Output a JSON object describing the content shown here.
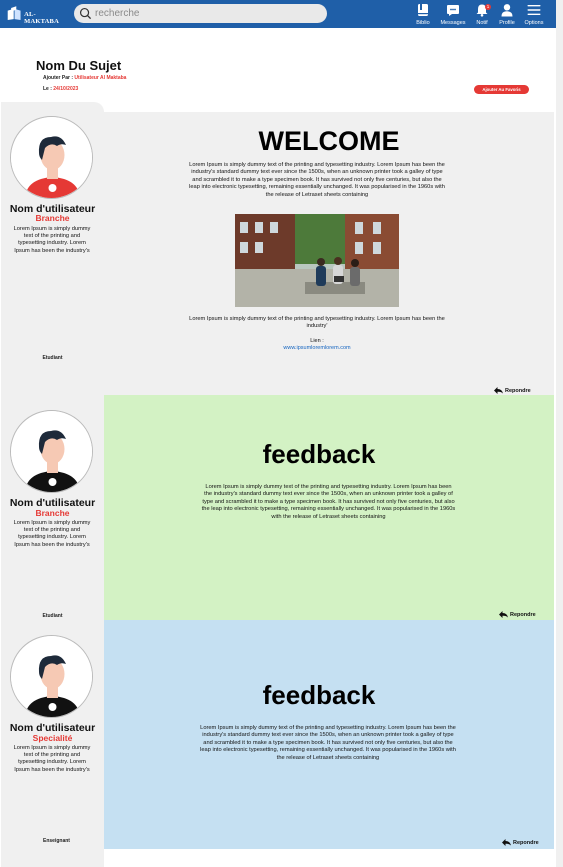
{
  "header": {
    "logo_text": "AL-MAKTABA",
    "search_placeholder": "recherche",
    "nav": [
      {
        "label": "Biblio"
      },
      {
        "label": "Messages"
      },
      {
        "label": "Notif",
        "badge": "1"
      },
      {
        "label": "Profile"
      },
      {
        "label": "Options"
      }
    ]
  },
  "subject": {
    "title": "Nom Du Sujet",
    "added_by_label": "Ajouter Par :",
    "added_by_value": "Utilisateur Al Maktaba",
    "date_label": "Le :",
    "date_value": "24/10/2023",
    "favorite_button": "Ajouter Au Favoris"
  },
  "posts": [
    {
      "user_name": "Nom d'utilisateur",
      "branch": "Branche",
      "bio": "Lorem Ipsum is simply dummy text of the printing and typesetting industry. Lorem Ipsum has been the industry's",
      "role": "Etudiant",
      "title": "WELCOME",
      "body": "Lorem Ipsum is simply dummy text of the printing and typesetting industry. Lorem Ipsum has been the industry's standard dummy text ever since the 1500s, when an unknown printer took a galley of type and scrambled it to make a type specimen book. It has survived not only five centuries, but also the leap into electronic typesetting, remaining essentially unchanged. It was popularised in the 1960s with the release of Letraset sheets containing",
      "body2": "Lorem Ipsum is simply dummy text of the printing and typesetting industry. Lorem Ipsum has been the industry'",
      "link_label": "Lien :",
      "link": "www.ipsumloremlorem.com",
      "reply": "Repondre",
      "bg": "#f0f0f0"
    },
    {
      "user_name": "Nom d'utilisateur",
      "branch": "Branche",
      "bio": "Lorem Ipsum is simply dummy text of the printing and typesetting industry. Lorem Ipsum has been the industry's",
      "role": "Etudiant",
      "title": "feedback",
      "body": "Lorem Ipsum is simply dummy text of the printing and typesetting industry. Lorem Ipsum has been the industry's standard dummy text ever since the 1500s, when an unknown printer took a galley of type and scrambled it to make a type specimen book. It has survived not only five centuries, but also the leap into electronic typesetting, remaining essentially unchanged. It was popularised in the 1960s with the release of Letraset sheets containing",
      "reply": "Repondre",
      "bg": "#d3f2c4"
    },
    {
      "user_name": "Nom d'utilisateur",
      "branch": "Specialité",
      "bio": "Lorem Ipsum is simply dummy text of the printing and typesetting industry. Lorem Ipsum has been the industry's",
      "role": "Enseignant",
      "title": "feedback",
      "body": "Lorem Ipsum is simply dummy text of the printing and typesetting industry. Lorem Ipsum has been the industry's standard dummy text ever since the 1500s, when an unknown printer took a galley of type and scrambled it to make a type specimen book. It has survived not only five centuries, but also the leap into electronic typesetting, remaining essentially unchanged. It was popularised in the 1960s with the release of Letraset sheets containing",
      "reply": "Repondre",
      "bg": "#c5e0f2"
    }
  ],
  "colors": {
    "topbar": "#1f5fa8",
    "accent_red": "#e53935",
    "feedback_green": "#d3f2c4",
    "feedback_blue": "#c5e0f2",
    "sidebar_grey": "#f0f0f0"
  }
}
